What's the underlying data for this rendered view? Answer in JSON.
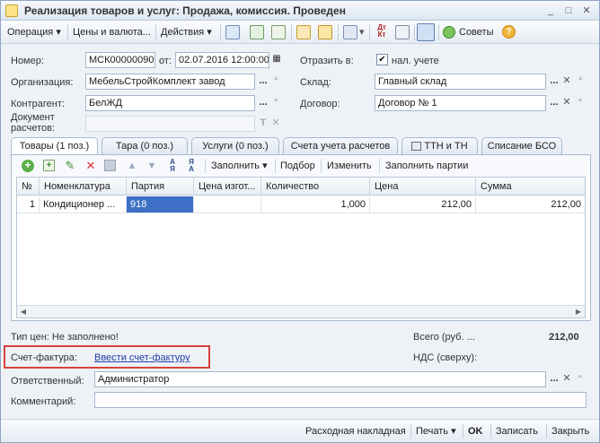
{
  "window": {
    "title": "Реализация товаров и услуг: Продажа, комиссия. Проведен",
    "controls": [
      "_",
      "□",
      "✕"
    ]
  },
  "toolbar": {
    "operation": "Операция",
    "prices": "Цены и валюта...",
    "actions": "Действия",
    "tips": "Советы",
    "help": "?",
    "dt_kt_top": "Дт",
    "dt_kt_bottom": "Кт"
  },
  "header": {
    "number_label": "Номер:",
    "number_value": "МСК00000090",
    "from_label": "от:",
    "date_value": "02.07.2016 12:00:00",
    "reflect_label": "Отразить в:",
    "tax_label": "нал. учете",
    "tax_checked": "✔",
    "org_label": "Организация:",
    "org_value": "МебельСтройКомплект завод",
    "warehouse_label": "Склад:",
    "warehouse_value": "Главный склад",
    "contractor_label": "Контрагент:",
    "contractor_value": "БелЖД",
    "contract_label": "Договор:",
    "contract_value": "Договор № 1",
    "settlement_doc_label_1": "Документ",
    "settlement_doc_label_2": "расчетов:",
    "settlement_doc_value": ""
  },
  "tabs": [
    {
      "label": "Товары (1 поз.)"
    },
    {
      "label": "Тара (0 поз.)"
    },
    {
      "label": "Услуги (0 поз.)"
    },
    {
      "label": "Счета учета расчетов"
    },
    {
      "label": "ТТН и ТН"
    },
    {
      "label": "Списание БСО"
    }
  ],
  "subtoolbar": {
    "fill": "Заполнить",
    "selection": "Подбор",
    "change": "Изменить",
    "fill_batches": "Заполнить партии"
  },
  "grid": {
    "columns": [
      "№",
      "Номенклатура",
      "Партия",
      "Цена изгот...",
      "Количество",
      "Цена",
      "Сумма"
    ],
    "rows": [
      [
        "1",
        "Кондиционер ...",
        "918",
        "",
        "1,000",
        "212,00",
        "212,00"
      ]
    ]
  },
  "footer": {
    "price_type": "Тип цен: Не заполнено!",
    "total_label": "Всего (руб. ...",
    "total_value": "212,00",
    "vat_label": "НДС (сверху):",
    "invoice_label": "Счет-фактура:",
    "invoice_link": "Ввести счет-фактуру",
    "responsible_label": "Ответственный:",
    "responsible_value": "Администратор",
    "comment_label": "Комментарий:",
    "comment_value": ""
  },
  "bottombar": {
    "waybill": "Расходная накладная",
    "print": "Печать",
    "ok": "OK",
    "save": "Записать",
    "close": "Закрыть"
  },
  "colors": {
    "selection": "#3d6fc6",
    "link": "#1f3fa6",
    "highlight": "#d8423b"
  }
}
